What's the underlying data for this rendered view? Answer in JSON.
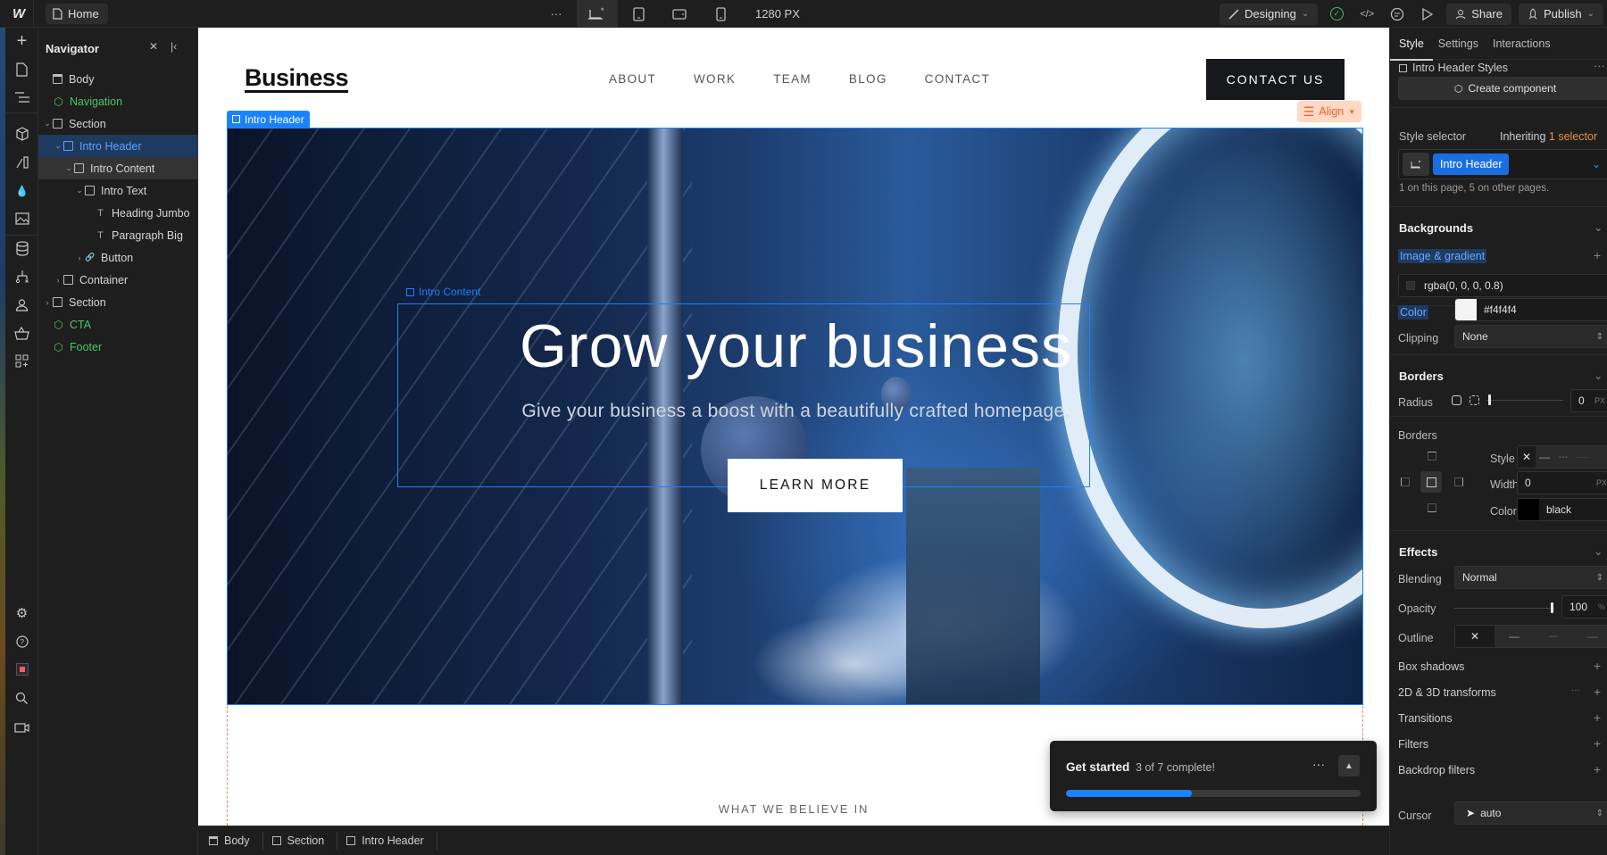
{
  "topbar": {
    "page_label": "Home",
    "more_label": "···",
    "canvas_width": "1280 PX",
    "mode_label": "Designing",
    "share_label": "Share",
    "publish_label": "Publish"
  },
  "navigator": {
    "title": "Navigator",
    "tree": [
      {
        "label": "Body",
        "type": "body",
        "depth": 0
      },
      {
        "label": "Navigation",
        "type": "component",
        "depth": 0
      },
      {
        "label": "Section",
        "type": "box",
        "depth": 0,
        "expanded": true
      },
      {
        "label": "Intro Header",
        "type": "box",
        "depth": 1,
        "expanded": true,
        "selected": true
      },
      {
        "label": "Intro Content",
        "type": "box",
        "depth": 2,
        "expanded": true
      },
      {
        "label": "Intro Text",
        "type": "box",
        "depth": 3,
        "expanded": true
      },
      {
        "label": "Heading Jumbo",
        "type": "text",
        "depth": 4
      },
      {
        "label": "Paragraph Big",
        "type": "text",
        "depth": 4
      },
      {
        "label": "Button",
        "type": "link",
        "depth": 3
      },
      {
        "label": "Container",
        "type": "box",
        "depth": 1
      },
      {
        "label": "Section",
        "type": "box",
        "depth": 0
      },
      {
        "label": "CTA",
        "type": "component",
        "depth": 0
      },
      {
        "label": "Footer",
        "type": "component",
        "depth": 0
      }
    ]
  },
  "canvas": {
    "brand": "Business",
    "menu": [
      "ABOUT",
      "WORK",
      "TEAM",
      "BLOG",
      "CONTACT"
    ],
    "contact_button": "CONTACT US",
    "align_label": "Align",
    "intro_header_badge": "Intro Header",
    "intro_content_label": "Intro Content",
    "hero_heading": "Grow your business",
    "hero_paragraph": "Give your business a boost with a beautifully crafted homepage.",
    "hero_button": "LEARN MORE",
    "section_kicker": "WHAT WE BELIEVE IN"
  },
  "get_started": {
    "title": "Get started",
    "status": "3 of 7 complete!",
    "completed": 3,
    "total": 7
  },
  "breadcrumbs": [
    "Body",
    "Section",
    "Intro Header"
  ],
  "style_panel": {
    "tabs": [
      "Style",
      "Settings",
      "Interactions"
    ],
    "active_tab": "Style",
    "element_styles": "Intro Header Styles",
    "create_component": "Create component",
    "style_selector_label": "Style selector",
    "inheriting_prefix": "Inheriting",
    "inheriting_link": "1 selector",
    "selector_chip": "Intro Header",
    "selector_usage": "1 on this page, 5 on other pages.",
    "backgrounds": {
      "title": "Backgrounds",
      "image_gradient_label": "Image & gradient",
      "layer_value": "rgba(0, 0, 0, 0.8)",
      "color_label": "Color",
      "color_value": "#f4f4f4",
      "clipping_label": "Clipping",
      "clipping_value": "None"
    },
    "borders": {
      "title": "Borders",
      "radius_label": "Radius",
      "radius_value": "0",
      "radius_unit": "PX",
      "borders_label": "Borders",
      "style_label": "Style",
      "width_label": "Width",
      "width_value": "0",
      "width_unit": "PX",
      "color_label": "Color",
      "color_value": "black"
    },
    "effects": {
      "title": "Effects",
      "blending_label": "Blending",
      "blending_value": "Normal",
      "opacity_label": "Opacity",
      "opacity_value": "100",
      "opacity_unit": "%",
      "outline_label": "Outline",
      "rows": [
        "Box shadows",
        "2D & 3D transforms",
        "Transitions",
        "Filters",
        "Backdrop filters"
      ],
      "cursor_label": "Cursor",
      "cursor_value": "auto"
    }
  },
  "colors": {
    "accent": "#1a82ff",
    "component_green": "#4cc36d",
    "align_orange": "#f1622a",
    "panel_bg": "#1e1e1e"
  }
}
